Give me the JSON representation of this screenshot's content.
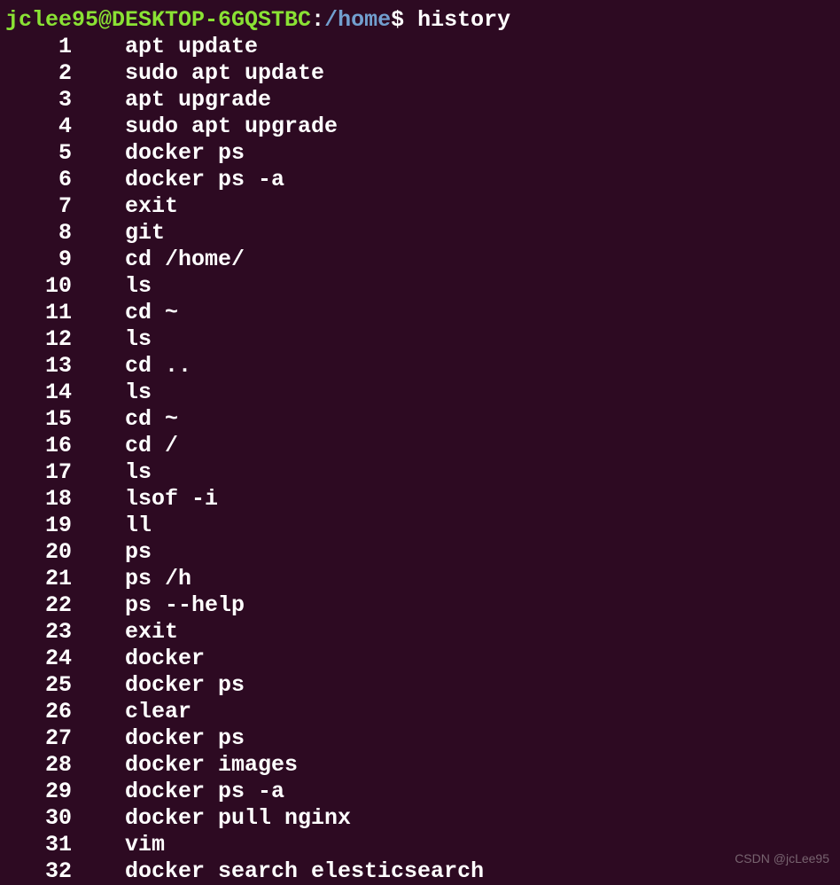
{
  "prompt": {
    "user_host": "jclee95@DESKTOP-6GQSTBC",
    "colon": ":",
    "path": "/home",
    "dollar": "$ ",
    "command": "history"
  },
  "history": [
    {
      "num": "1",
      "cmd": "apt update"
    },
    {
      "num": "2",
      "cmd": "sudo apt update"
    },
    {
      "num": "3",
      "cmd": "apt upgrade"
    },
    {
      "num": "4",
      "cmd": "sudo apt upgrade"
    },
    {
      "num": "5",
      "cmd": "docker ps"
    },
    {
      "num": "6",
      "cmd": "docker ps -a"
    },
    {
      "num": "7",
      "cmd": "exit"
    },
    {
      "num": "8",
      "cmd": "git"
    },
    {
      "num": "9",
      "cmd": "cd /home/"
    },
    {
      "num": "10",
      "cmd": "ls"
    },
    {
      "num": "11",
      "cmd": "cd ~"
    },
    {
      "num": "12",
      "cmd": "ls"
    },
    {
      "num": "13",
      "cmd": "cd .."
    },
    {
      "num": "14",
      "cmd": "ls"
    },
    {
      "num": "15",
      "cmd": "cd ~"
    },
    {
      "num": "16",
      "cmd": "cd /"
    },
    {
      "num": "17",
      "cmd": "ls"
    },
    {
      "num": "18",
      "cmd": "lsof -i"
    },
    {
      "num": "19",
      "cmd": "ll"
    },
    {
      "num": "20",
      "cmd": "ps"
    },
    {
      "num": "21",
      "cmd": "ps /h"
    },
    {
      "num": "22",
      "cmd": "ps --help"
    },
    {
      "num": "23",
      "cmd": "exit"
    },
    {
      "num": "24",
      "cmd": "docker"
    },
    {
      "num": "25",
      "cmd": "docker ps"
    },
    {
      "num": "26",
      "cmd": "clear"
    },
    {
      "num": "27",
      "cmd": "docker ps"
    },
    {
      "num": "28",
      "cmd": "docker images"
    },
    {
      "num": "29",
      "cmd": "docker ps -a"
    },
    {
      "num": "30",
      "cmd": "docker pull nginx"
    },
    {
      "num": "31",
      "cmd": "vim"
    },
    {
      "num": "32",
      "cmd": "docker search elesticsearch"
    }
  ],
  "watermark": "CSDN @jcLee95"
}
